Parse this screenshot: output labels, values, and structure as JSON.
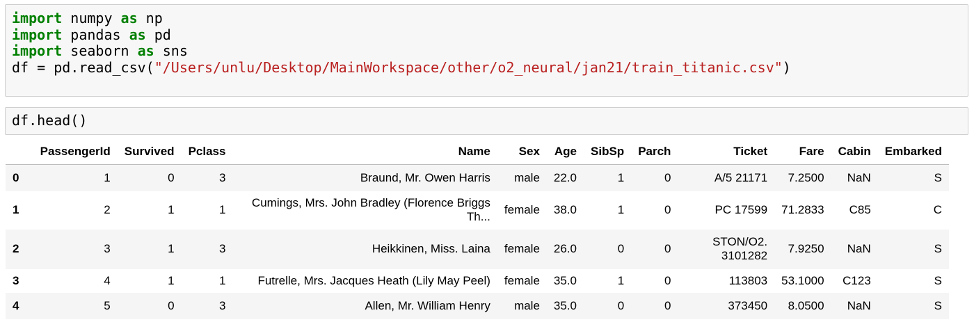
{
  "cells": [
    {
      "lines": [
        [
          {
            "t": "kw",
            "v": "import"
          },
          {
            "t": "",
            "v": " numpy "
          },
          {
            "t": "kw",
            "v": "as"
          },
          {
            "t": "",
            "v": " np"
          }
        ],
        [
          {
            "t": "kw",
            "v": "import"
          },
          {
            "t": "",
            "v": " pandas "
          },
          {
            "t": "kw",
            "v": "as"
          },
          {
            "t": "",
            "v": " pd"
          }
        ],
        [
          {
            "t": "kw",
            "v": "import"
          },
          {
            "t": "",
            "v": " seaborn "
          },
          {
            "t": "kw",
            "v": "as"
          },
          {
            "t": "",
            "v": " sns"
          }
        ],
        [
          {
            "t": "",
            "v": "df = pd.read_csv("
          },
          {
            "t": "str",
            "v": "\"/Users/unlu/Desktop/MainWorkspace/other/o2_neural/jan21/train_titanic.csv\""
          },
          {
            "t": "",
            "v": ")"
          }
        ]
      ]
    },
    {
      "lines": [
        [
          {
            "t": "",
            "v": "df.head()"
          }
        ]
      ]
    }
  ],
  "table": {
    "columns": [
      "",
      "PassengerId",
      "Survived",
      "Pclass",
      "Name",
      "Sex",
      "Age",
      "SibSp",
      "Parch",
      "Ticket",
      "Fare",
      "Cabin",
      "Embarked"
    ],
    "rows": [
      [
        "0",
        "1",
        "0",
        "3",
        "Braund, Mr. Owen Harris",
        "male",
        "22.0",
        "1",
        "0",
        "A/5 21171",
        "7.2500",
        "NaN",
        "S"
      ],
      [
        "1",
        "2",
        "1",
        "1",
        "Cumings, Mrs. John Bradley (Florence Briggs Th...",
        "female",
        "38.0",
        "1",
        "0",
        "PC 17599",
        "71.2833",
        "C85",
        "C"
      ],
      [
        "2",
        "3",
        "1",
        "3",
        "Heikkinen, Miss. Laina",
        "female",
        "26.0",
        "0",
        "0",
        "STON/O2. 3101282",
        "7.9250",
        "NaN",
        "S"
      ],
      [
        "3",
        "4",
        "1",
        "1",
        "Futrelle, Mrs. Jacques Heath (Lily May Peel)",
        "female",
        "35.0",
        "1",
        "0",
        "113803",
        "53.1000",
        "C123",
        "S"
      ],
      [
        "4",
        "5",
        "0",
        "3",
        "Allen, Mr. William Henry",
        "male",
        "35.0",
        "0",
        "0",
        "373450",
        "8.0500",
        "NaN",
        "S"
      ]
    ]
  },
  "colors": {
    "keyword": "#008000",
    "string": "#ba2121",
    "cell_bg": "#f7f7f7",
    "row_alt": "#f5f5f5"
  }
}
